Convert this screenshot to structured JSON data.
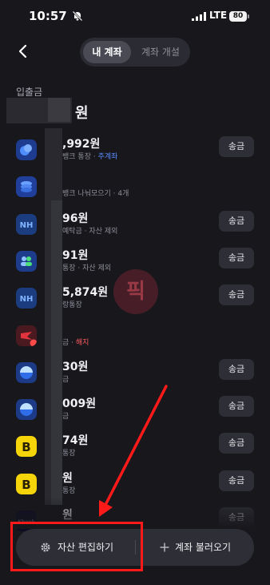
{
  "status": {
    "time": "10:57",
    "network": "LTE",
    "battery": "80"
  },
  "tabs": {
    "active": "내 계좌",
    "inactive": "계좌 개설"
  },
  "section_title": "입출금",
  "total_suffix": "원",
  "accounts": [
    {
      "amount": ",992원",
      "sub": "뱅크 통장 · ",
      "tag": "주계좌",
      "tag_style": "hl",
      "send": "송금",
      "icon": "blue-swirl-icon"
    },
    {
      "amount": "",
      "sub": "뱅크 나눠모으기 · 4개",
      "tag": "",
      "tag_style": "",
      "send": "",
      "icon": "stack-icon"
    },
    {
      "amount": "96원",
      "sub": "예탁금 · 자산 제외",
      "tag": "",
      "tag_style": "",
      "send": "송금",
      "icon": "nh-icon"
    },
    {
      "amount": "91원",
      "sub": "통장 · 자산 제외",
      "tag": "",
      "tag_style": "",
      "send": "송금",
      "icon": "people-icon"
    },
    {
      "amount": "5,874원",
      "sub": "랑통장",
      "tag": "",
      "tag_style": "",
      "send": "송금",
      "icon": "nh-icon"
    },
    {
      "amount": "",
      "sub": "금 · ",
      "tag": "해지",
      "tag_style": "warn",
      "send": "",
      "icon": "red-bank-icon"
    },
    {
      "amount": "30원",
      "sub": "금",
      "tag": "",
      "tag_style": "",
      "send": "송금",
      "icon": "blue-dome-icon"
    },
    {
      "amount": "009원",
      "sub": "금",
      "tag": "",
      "tag_style": "",
      "send": "송금",
      "icon": "blue-dome-icon"
    },
    {
      "amount": "74원",
      "sub": "통장",
      "tag": "",
      "tag_style": "",
      "send": "송금",
      "icon": "kakao-b-icon"
    },
    {
      "amount": "원",
      "sub": "통장",
      "tag": "",
      "tag_style": "",
      "send": "송금",
      "icon": "kakao-b-icon"
    },
    {
      "amount": "원",
      "sub": "",
      "tag": "",
      "tag_style": "",
      "send": "송금",
      "icon": "kbank-icon"
    }
  ],
  "watermark": "픽",
  "bottom": {
    "edit": "자산 편집하기",
    "import": "계좌 불러오기"
  },
  "colors": {
    "background": "#17171c",
    "accent": "#5b8cff",
    "warn": "#ff5a5f",
    "annotation": "#ff1a1a"
  }
}
